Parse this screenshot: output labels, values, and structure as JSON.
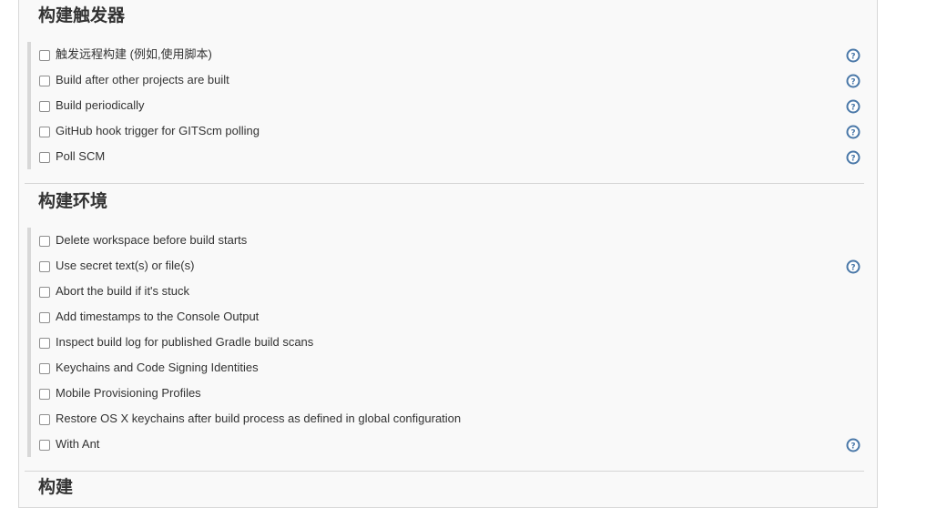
{
  "sections": [
    {
      "title": "构建触发器",
      "options": [
        {
          "label": "触发远程构建 (例如,使用脚本)",
          "checked": false,
          "help_icon": true
        },
        {
          "label": "Build after other projects are built",
          "checked": false,
          "help_icon": true
        },
        {
          "label": "Build periodically",
          "checked": false,
          "help_icon": true
        },
        {
          "label": "GitHub hook trigger for GITScm polling",
          "checked": false,
          "help_icon": true
        },
        {
          "label": "Poll SCM",
          "checked": false,
          "help_icon": true
        }
      ]
    },
    {
      "title": "构建环境",
      "options": [
        {
          "label": "Delete workspace before build starts",
          "checked": false,
          "help_icon": false
        },
        {
          "label": "Use secret text(s) or file(s)",
          "checked": false,
          "help_icon": true
        },
        {
          "label": "Abort the build if it's stuck",
          "checked": false,
          "help_icon": false
        },
        {
          "label": "Add timestamps to the Console Output",
          "checked": false,
          "help_icon": false
        },
        {
          "label": "Inspect build log for published Gradle build scans",
          "checked": false,
          "help_icon": false
        },
        {
          "label": "Keychains and Code Signing Identities",
          "checked": false,
          "help_icon": false
        },
        {
          "label": "Mobile Provisioning Profiles",
          "checked": false,
          "help_icon": false
        },
        {
          "label": "Restore OS X keychains after build process as defined in global configuration",
          "checked": false,
          "help_icon": false
        },
        {
          "label": "With Ant",
          "checked": false,
          "help_icon": true
        }
      ]
    },
    {
      "title": "构建",
      "options": []
    }
  ],
  "colors": {
    "help_icon": "#4a78a8",
    "panel_background": "#f9f9f9",
    "divider": "#d6d6d6"
  }
}
